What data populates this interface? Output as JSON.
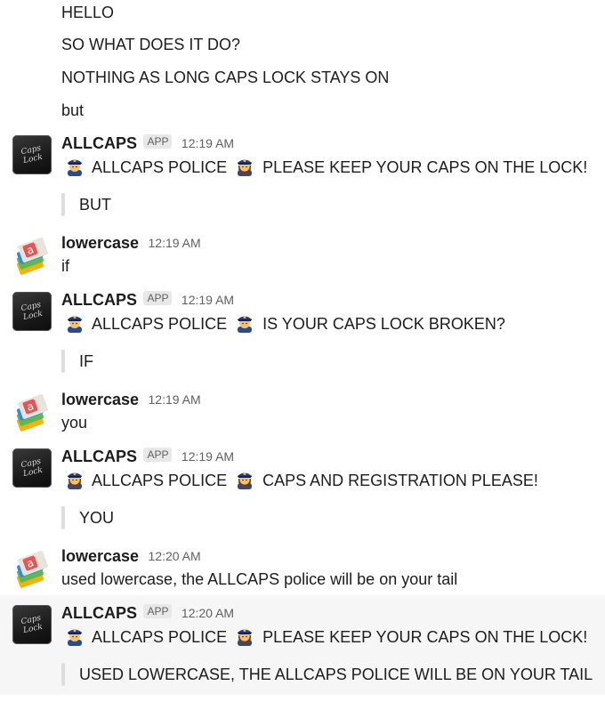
{
  "continuation_lines": [
    "HELLO",
    "SO WHAT DOES IT DO?",
    "NOTHING AS LONG CAPS LOCK STAYS ON",
    "but"
  ],
  "avatars": {
    "allcaps_text": "Caps Lock"
  },
  "messages": [
    {
      "sender": "ALLCAPS",
      "badge": "APP",
      "time": "12:19 AM",
      "police_label": "ALLCAPS POLICE",
      "text": "PLEASE KEEP YOUR CAPS ON THE LOCK!",
      "quote": "BUT"
    },
    {
      "sender": "lowercase",
      "time": "12:19 AM",
      "text": "if"
    },
    {
      "sender": "ALLCAPS",
      "badge": "APP",
      "time": "12:19 AM",
      "police_label": "ALLCAPS POLICE",
      "text": "IS YOUR CAPS LOCK BROKEN?",
      "quote": "IF"
    },
    {
      "sender": "lowercase",
      "time": "12:19 AM",
      "text": "you"
    },
    {
      "sender": "ALLCAPS",
      "badge": "APP",
      "time": "12:19 AM",
      "police_label": "ALLCAPS POLICE",
      "text": "CAPS AND REGISTRATION PLEASE!",
      "quote": "YOU"
    },
    {
      "sender": "lowercase",
      "time": "12:20 AM",
      "text": "used lowercase, the ALLCAPS police will be on your tail"
    },
    {
      "sender": "ALLCAPS",
      "badge": "APP",
      "time": "12:20 AM",
      "police_label": "ALLCAPS POLICE",
      "text": "PLEASE KEEP YOUR CAPS ON THE LOCK!",
      "quote": "USED LOWERCASE, THE ALLCAPS POLICE WILL BE ON YOUR TAIL"
    }
  ],
  "icons": {
    "police_male": "police-officer-man-emoji",
    "police_female": "police-officer-woman-emoji"
  },
  "colors": {
    "timestamp": "#616061",
    "quote_bar": "#dddddd",
    "highlight": "#f6f6f6",
    "badge_bg": "#e8e8e8"
  }
}
